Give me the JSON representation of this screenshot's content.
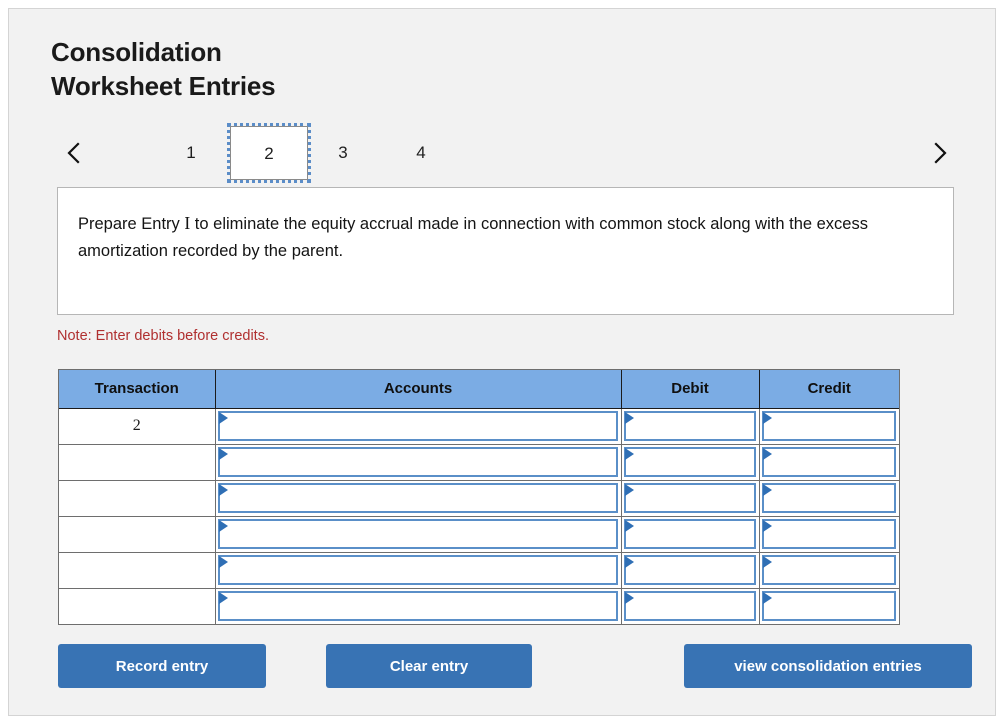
{
  "header": {
    "title_line1": "Consolidation",
    "title_line2": "Worksheet Entries"
  },
  "nav": {
    "prev_icon": "chevron-left-icon",
    "next_icon": "chevron-right-icon",
    "tabs": [
      {
        "label": "1",
        "active": false
      },
      {
        "label": "2",
        "active": true
      },
      {
        "label": "3",
        "active": false
      },
      {
        "label": "4",
        "active": false
      }
    ]
  },
  "instruction": {
    "text_before": "Prepare Entry ",
    "emphasis": "I",
    "text_after": " to eliminate the equity accrual made in connection with common stock along with the excess amortization recorded by the parent."
  },
  "note": {
    "text": "Note: Enter debits before credits.",
    "color": "#b03030"
  },
  "journal": {
    "columns": [
      "Transaction",
      "Accounts",
      "Debit",
      "Credit"
    ],
    "rows": [
      {
        "transaction": "2",
        "accounts": "",
        "debit": "",
        "credit": ""
      },
      {
        "transaction": "",
        "accounts": "",
        "debit": "",
        "credit": ""
      },
      {
        "transaction": "",
        "accounts": "",
        "debit": "",
        "credit": ""
      },
      {
        "transaction": "",
        "accounts": "",
        "debit": "",
        "credit": ""
      },
      {
        "transaction": "",
        "accounts": "",
        "debit": "",
        "credit": ""
      },
      {
        "transaction": "",
        "accounts": "",
        "debit": "",
        "credit": ""
      }
    ],
    "header_color": "#7bace4",
    "cell_border_color": "#5a8fc8"
  },
  "actions": {
    "record_label": "Record entry",
    "clear_label": "Clear entry",
    "view_label": "view consolidation entries",
    "button_color": "#3873b4"
  }
}
